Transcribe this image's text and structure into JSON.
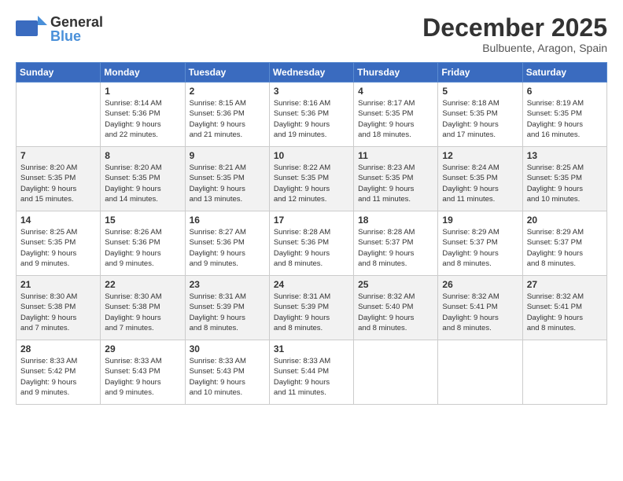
{
  "header": {
    "logo_line1": "General",
    "logo_line2": "Blue",
    "month": "December 2025",
    "location": "Bulbuente, Aragon, Spain"
  },
  "days_of_week": [
    "Sunday",
    "Monday",
    "Tuesday",
    "Wednesday",
    "Thursday",
    "Friday",
    "Saturday"
  ],
  "weeks": [
    [
      {
        "day": "",
        "info": ""
      },
      {
        "day": "1",
        "info": "Sunrise: 8:14 AM\nSunset: 5:36 PM\nDaylight: 9 hours\nand 22 minutes."
      },
      {
        "day": "2",
        "info": "Sunrise: 8:15 AM\nSunset: 5:36 PM\nDaylight: 9 hours\nand 21 minutes."
      },
      {
        "day": "3",
        "info": "Sunrise: 8:16 AM\nSunset: 5:36 PM\nDaylight: 9 hours\nand 19 minutes."
      },
      {
        "day": "4",
        "info": "Sunrise: 8:17 AM\nSunset: 5:35 PM\nDaylight: 9 hours\nand 18 minutes."
      },
      {
        "day": "5",
        "info": "Sunrise: 8:18 AM\nSunset: 5:35 PM\nDaylight: 9 hours\nand 17 minutes."
      },
      {
        "day": "6",
        "info": "Sunrise: 8:19 AM\nSunset: 5:35 PM\nDaylight: 9 hours\nand 16 minutes."
      }
    ],
    [
      {
        "day": "7",
        "info": "Sunrise: 8:20 AM\nSunset: 5:35 PM\nDaylight: 9 hours\nand 15 minutes."
      },
      {
        "day": "8",
        "info": "Sunrise: 8:20 AM\nSunset: 5:35 PM\nDaylight: 9 hours\nand 14 minutes."
      },
      {
        "day": "9",
        "info": "Sunrise: 8:21 AM\nSunset: 5:35 PM\nDaylight: 9 hours\nand 13 minutes."
      },
      {
        "day": "10",
        "info": "Sunrise: 8:22 AM\nSunset: 5:35 PM\nDaylight: 9 hours\nand 12 minutes."
      },
      {
        "day": "11",
        "info": "Sunrise: 8:23 AM\nSunset: 5:35 PM\nDaylight: 9 hours\nand 11 minutes."
      },
      {
        "day": "12",
        "info": "Sunrise: 8:24 AM\nSunset: 5:35 PM\nDaylight: 9 hours\nand 11 minutes."
      },
      {
        "day": "13",
        "info": "Sunrise: 8:25 AM\nSunset: 5:35 PM\nDaylight: 9 hours\nand 10 minutes."
      }
    ],
    [
      {
        "day": "14",
        "info": "Sunrise: 8:25 AM\nSunset: 5:35 PM\nDaylight: 9 hours\nand 9 minutes."
      },
      {
        "day": "15",
        "info": "Sunrise: 8:26 AM\nSunset: 5:36 PM\nDaylight: 9 hours\nand 9 minutes."
      },
      {
        "day": "16",
        "info": "Sunrise: 8:27 AM\nSunset: 5:36 PM\nDaylight: 9 hours\nand 9 minutes."
      },
      {
        "day": "17",
        "info": "Sunrise: 8:28 AM\nSunset: 5:36 PM\nDaylight: 9 hours\nand 8 minutes."
      },
      {
        "day": "18",
        "info": "Sunrise: 8:28 AM\nSunset: 5:37 PM\nDaylight: 9 hours\nand 8 minutes."
      },
      {
        "day": "19",
        "info": "Sunrise: 8:29 AM\nSunset: 5:37 PM\nDaylight: 9 hours\nand 8 minutes."
      },
      {
        "day": "20",
        "info": "Sunrise: 8:29 AM\nSunset: 5:37 PM\nDaylight: 9 hours\nand 8 minutes."
      }
    ],
    [
      {
        "day": "21",
        "info": "Sunrise: 8:30 AM\nSunset: 5:38 PM\nDaylight: 9 hours\nand 7 minutes."
      },
      {
        "day": "22",
        "info": "Sunrise: 8:30 AM\nSunset: 5:38 PM\nDaylight: 9 hours\nand 7 minutes."
      },
      {
        "day": "23",
        "info": "Sunrise: 8:31 AM\nSunset: 5:39 PM\nDaylight: 9 hours\nand 8 minutes."
      },
      {
        "day": "24",
        "info": "Sunrise: 8:31 AM\nSunset: 5:39 PM\nDaylight: 9 hours\nand 8 minutes."
      },
      {
        "day": "25",
        "info": "Sunrise: 8:32 AM\nSunset: 5:40 PM\nDaylight: 9 hours\nand 8 minutes."
      },
      {
        "day": "26",
        "info": "Sunrise: 8:32 AM\nSunset: 5:41 PM\nDaylight: 9 hours\nand 8 minutes."
      },
      {
        "day": "27",
        "info": "Sunrise: 8:32 AM\nSunset: 5:41 PM\nDaylight: 9 hours\nand 8 minutes."
      }
    ],
    [
      {
        "day": "28",
        "info": "Sunrise: 8:33 AM\nSunset: 5:42 PM\nDaylight: 9 hours\nand 9 minutes."
      },
      {
        "day": "29",
        "info": "Sunrise: 8:33 AM\nSunset: 5:43 PM\nDaylight: 9 hours\nand 9 minutes."
      },
      {
        "day": "30",
        "info": "Sunrise: 8:33 AM\nSunset: 5:43 PM\nDaylight: 9 hours\nand 10 minutes."
      },
      {
        "day": "31",
        "info": "Sunrise: 8:33 AM\nSunset: 5:44 PM\nDaylight: 9 hours\nand 11 minutes."
      },
      {
        "day": "",
        "info": ""
      },
      {
        "day": "",
        "info": ""
      },
      {
        "day": "",
        "info": ""
      }
    ]
  ]
}
